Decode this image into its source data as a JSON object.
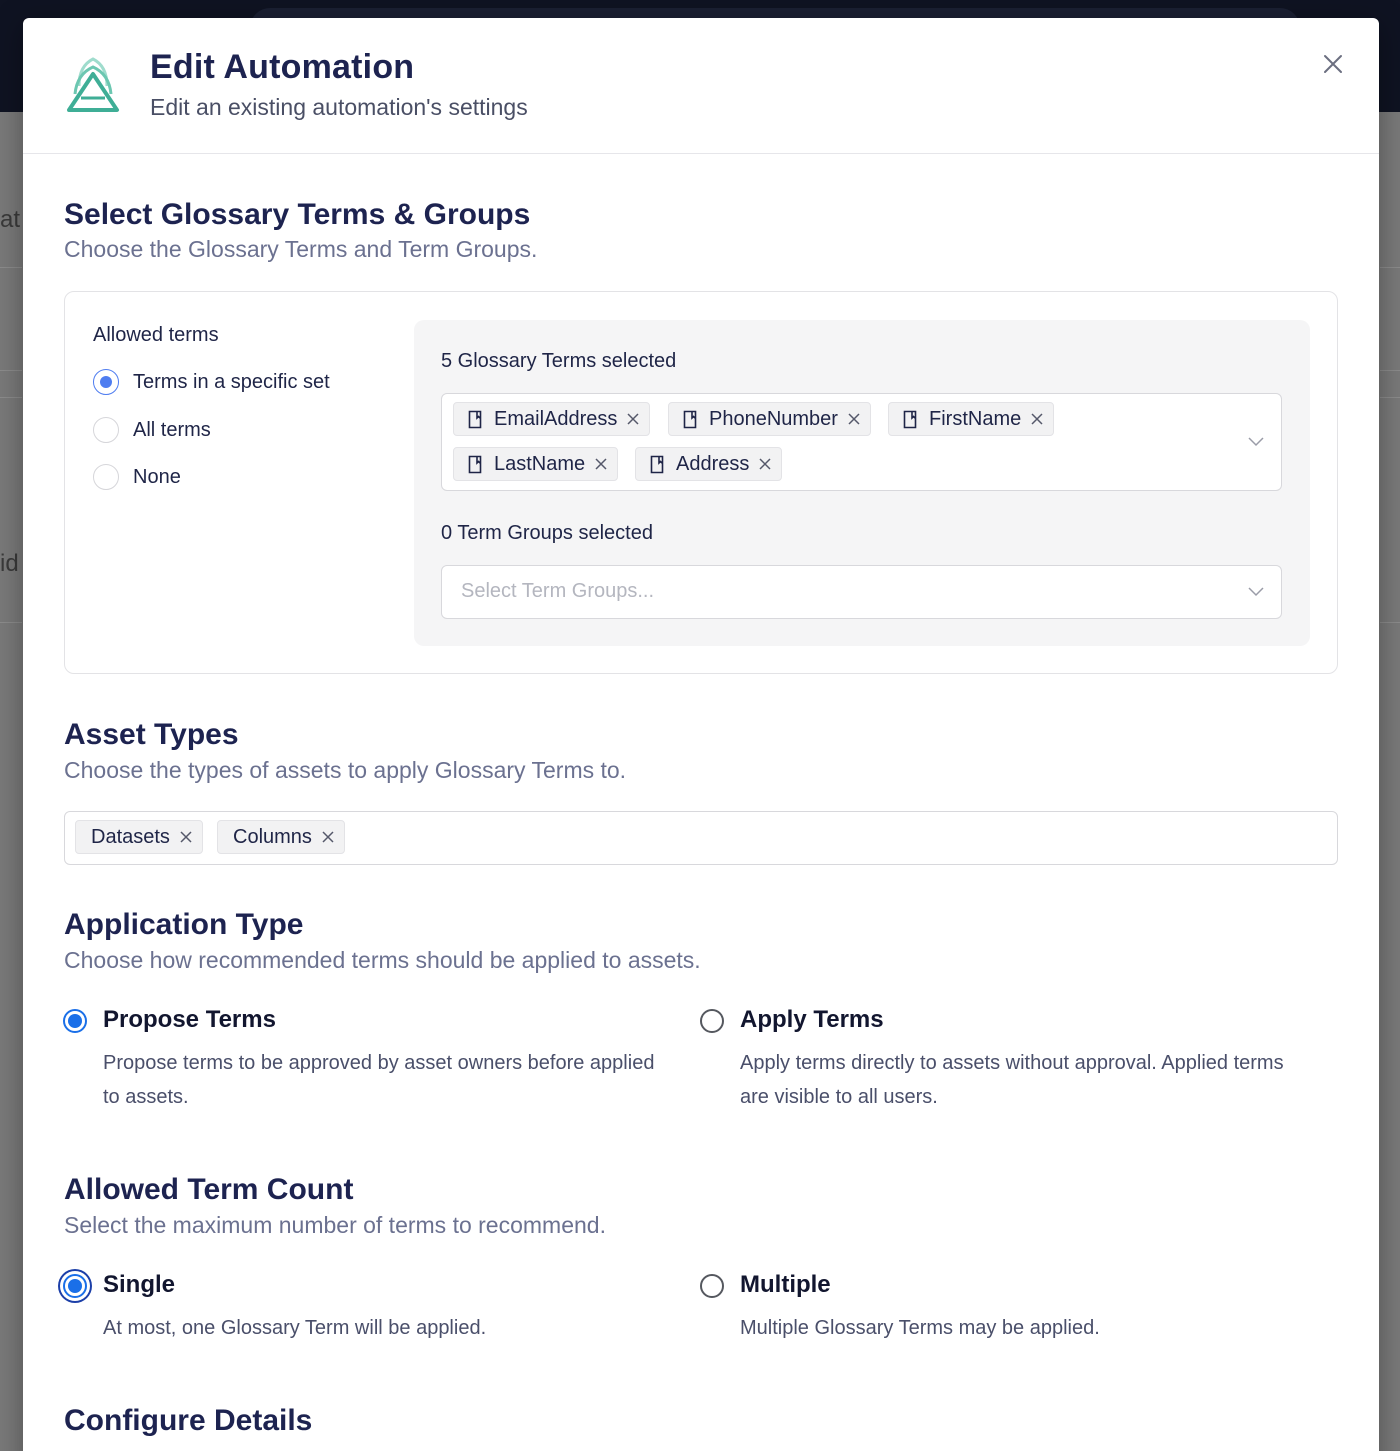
{
  "background": {
    "fragment_1": "at",
    "fragment_2": "id"
  },
  "modal": {
    "title": "Edit Automation",
    "subtitle": "Edit an existing automation's settings",
    "close_icon": "close-icon",
    "logo_icon": "triangle-layers-logo"
  },
  "glossary": {
    "title": "Select Glossary Terms & Groups",
    "description": "Choose the Glossary Terms and Term Groups.",
    "allowed_label": "Allowed terms",
    "options": [
      {
        "label": "Terms in a specific set",
        "checked": true
      },
      {
        "label": "All terms",
        "checked": false
      },
      {
        "label": "None",
        "checked": false
      }
    ],
    "terms_selected_label": "5 Glossary Terms selected",
    "terms": [
      "EmailAddress",
      "PhoneNumber",
      "FirstName",
      "LastName",
      "Address"
    ],
    "groups_selected_label": "0 Term Groups selected",
    "groups_placeholder": "Select Term Groups..."
  },
  "asset_types": {
    "title": "Asset Types",
    "description": "Choose the types of assets to apply Glossary Terms to.",
    "selected": [
      "Datasets",
      "Columns"
    ]
  },
  "application_type": {
    "title": "Application Type",
    "description": "Choose how recommended terms should be applied to assets.",
    "options": [
      {
        "title": "Propose Terms",
        "description": "Propose terms to be approved by asset owners before applied to assets.",
        "checked": true
      },
      {
        "title": "Apply Terms",
        "description": "Apply terms directly to assets without approval. Applied terms are visible to all users.",
        "checked": false
      }
    ]
  },
  "term_count": {
    "title": "Allowed Term Count",
    "description": "Select the maximum number of terms to recommend.",
    "options": [
      {
        "title": "Single",
        "description": "At most, one Glossary Term will be applied.",
        "checked": true
      },
      {
        "title": "Multiple",
        "description": "Multiple Glossary Terms may be applied.",
        "checked": false
      }
    ]
  },
  "configure": {
    "title": "Configure Details"
  },
  "colors": {
    "accent_blue": "#1a6fe8",
    "radio_blue": "#4f7df0",
    "heading_navy": "#1d2350",
    "logo_teal": "#3fae96"
  }
}
